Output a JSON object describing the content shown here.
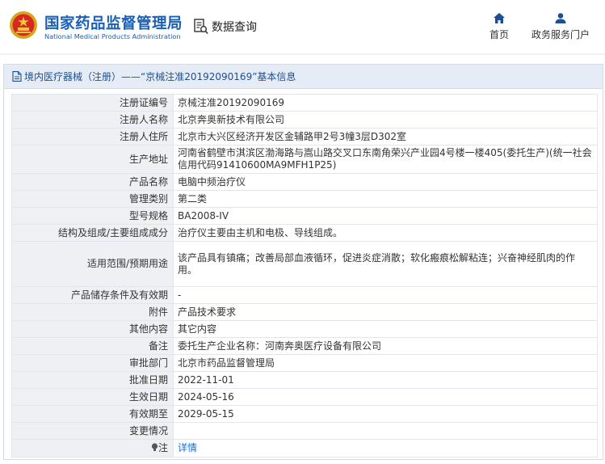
{
  "header": {
    "logo_cn": "国家药品监督管理局",
    "logo_en": "National Medical Products Administration",
    "search_label": "数据查询",
    "nav": [
      {
        "label": "首页",
        "icon": "home-icon"
      },
      {
        "label": "政务服务门户",
        "icon": "user-icon"
      }
    ]
  },
  "panel": {
    "title": "境内医疗器械（注册）——“京械注准20192090169”基本信息"
  },
  "rows": [
    {
      "key": "注册证编号",
      "value": "京械注准20192090169"
    },
    {
      "key": "注册人名称",
      "value": "北京奔奥新技术有限公司"
    },
    {
      "key": "注册人住所",
      "value": "北京市大兴区经济开发区金辅路甲2号3幢3层D302室"
    },
    {
      "key": "生产地址",
      "value": "河南省鹤壁市淇滨区渤海路与嵩山路交叉口东南角荣兴产业园4号楼一楼405(委托生产)(统一社会信用代码91410600MA9MFH1P25)"
    },
    {
      "key": "产品名称",
      "value": "电脑中频治疗仪"
    },
    {
      "key": "管理类别",
      "value": "第二类"
    },
    {
      "key": "型号规格",
      "value": "BA2008-IV"
    },
    {
      "key": "结构及组成/主要组成成分",
      "value": "治疗仪主要由主机和电极、导线组成。"
    },
    {
      "key": "适用范围/预期用途",
      "value": "该产品具有镇痛；改善局部血液循环，促进炎症消散；软化瘢痕松解粘连；兴奋神经肌肉的作用。"
    },
    {
      "key": "产品储存条件及有效期",
      "value": "-"
    },
    {
      "key": "附件",
      "value": "产品技术要求"
    },
    {
      "key": "其他内容",
      "value": "其它内容"
    },
    {
      "key": "备注",
      "value": "委托生产企业名称：河南奔奥医疗设备有限公司"
    },
    {
      "key": "审批部门",
      "value": "北京市药品监督管理局"
    },
    {
      "key": "批准日期",
      "value": "2022-11-01"
    },
    {
      "key": "生效日期",
      "value": "2024-05-16"
    },
    {
      "key": "有效期至",
      "value": "2029-05-15"
    },
    {
      "key": "变更情况",
      "value": ""
    },
    {
      "key": "注",
      "value": "详情",
      "icon": "bulb-icon"
    }
  ]
}
